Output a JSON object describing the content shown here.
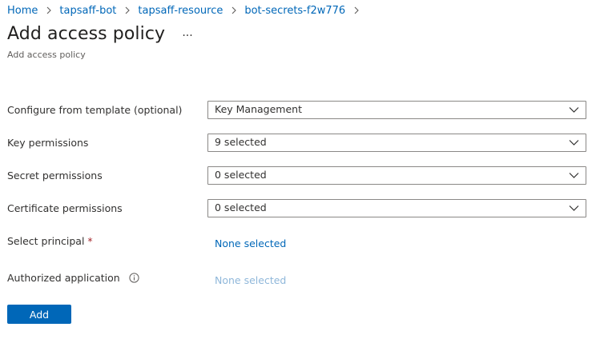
{
  "breadcrumb": {
    "items": [
      {
        "label": "Home"
      },
      {
        "label": "tapsaff-bot"
      },
      {
        "label": "tapsaff-resource"
      },
      {
        "label": "bot-secrets-f2w776"
      }
    ]
  },
  "header": {
    "title": "Add access policy",
    "more_label": "···",
    "subtitle": "Add access policy"
  },
  "form": {
    "template": {
      "label": "Configure from template (optional)",
      "value": "Key Management"
    },
    "key_permissions": {
      "label": "Key permissions",
      "value": "9 selected"
    },
    "secret_permissions": {
      "label": "Secret permissions",
      "value": "0 selected"
    },
    "certificate_permissions": {
      "label": "Certificate permissions",
      "value": "0 selected"
    },
    "principal": {
      "label": "Select principal",
      "required_mark": "*",
      "value": "None selected"
    },
    "authorized_application": {
      "label": "Authorized application",
      "value": "None selected",
      "info_icon": "info-icon"
    }
  },
  "actions": {
    "add_label": "Add"
  },
  "colors": {
    "link": "#0067b8",
    "link_disabled": "#8fb7da",
    "primary_button": "#0067b8",
    "required": "#a4262c",
    "border": "#8a8886"
  }
}
